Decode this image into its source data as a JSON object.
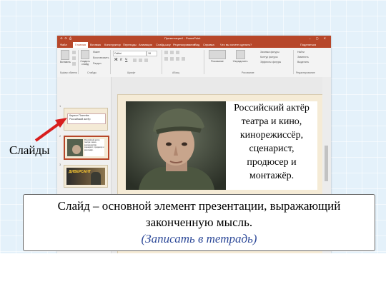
{
  "window": {
    "title": "Презентация1 - PowerPoint",
    "quick_access": "⟲ ⟳ ⎙",
    "controls": "‒ ▢ ✕"
  },
  "ribbon": {
    "tabs": [
      {
        "label": "Файл",
        "active": false
      },
      {
        "label": "Главная",
        "active": true
      },
      {
        "label": "Вставка",
        "active": false
      },
      {
        "label": "Конструктор",
        "active": false
      },
      {
        "label": "Переходы",
        "active": false
      },
      {
        "label": "Анимация",
        "active": false
      },
      {
        "label": "Слайд-шоу",
        "active": false
      },
      {
        "label": "Рецензирование",
        "active": false
      },
      {
        "label": "Вид",
        "active": false
      },
      {
        "label": "Справка",
        "active": false
      }
    ],
    "search_hint": "Что вы хотите сделать?",
    "share": "Поделиться",
    "paste": "Вставить",
    "new_slide": "Создать слайд",
    "layout": "Макет",
    "reset": "Восстановить",
    "section": "Раздел",
    "font_name": "Calibri",
    "font_size": "18",
    "drawing": "Рисование",
    "arrange": "Упорядочить",
    "fill": "Заливка фигуры",
    "outline": "Контур фигуры",
    "effects": "Эффекты фигуры",
    "find": "Найти",
    "replace": "Заменить",
    "select": "Выделить",
    "groups": {
      "clipboard": "Буфер обмена",
      "slides": "Слайды",
      "font": "Шрифт",
      "paragraph": "Абзац",
      "drawing": "Рисование",
      "editing": "Редактирование"
    }
  },
  "thumbnails": [
    {
      "number": "1",
      "line1": "Кирилл Плетнёв",
      "line2": "Российский актёр"
    },
    {
      "number": "2",
      "text": "Российский актёр театра и кино, кинорежиссёр, сценарист, продюсер и монтажёр."
    },
    {
      "number": "3",
      "title": "ДИВЕРСАНТ"
    }
  ],
  "slide": {
    "text_lines": [
      "Российский актёр",
      "театра и кино,",
      "кинорежиссёр,",
      "сценарист,",
      "продюсер и",
      "монтажёр."
    ]
  },
  "callout": {
    "label": "Слайды",
    "arrow_color": "#d81e1e"
  },
  "note": {
    "line1": "Слайд – основной элемент презентации, выражающий",
    "line2": "законченную мысль.",
    "line3": "(Записать в тетрадь)"
  },
  "colors": {
    "powerpoint_accent": "#b7472a",
    "note_accent": "#2e4a99"
  }
}
